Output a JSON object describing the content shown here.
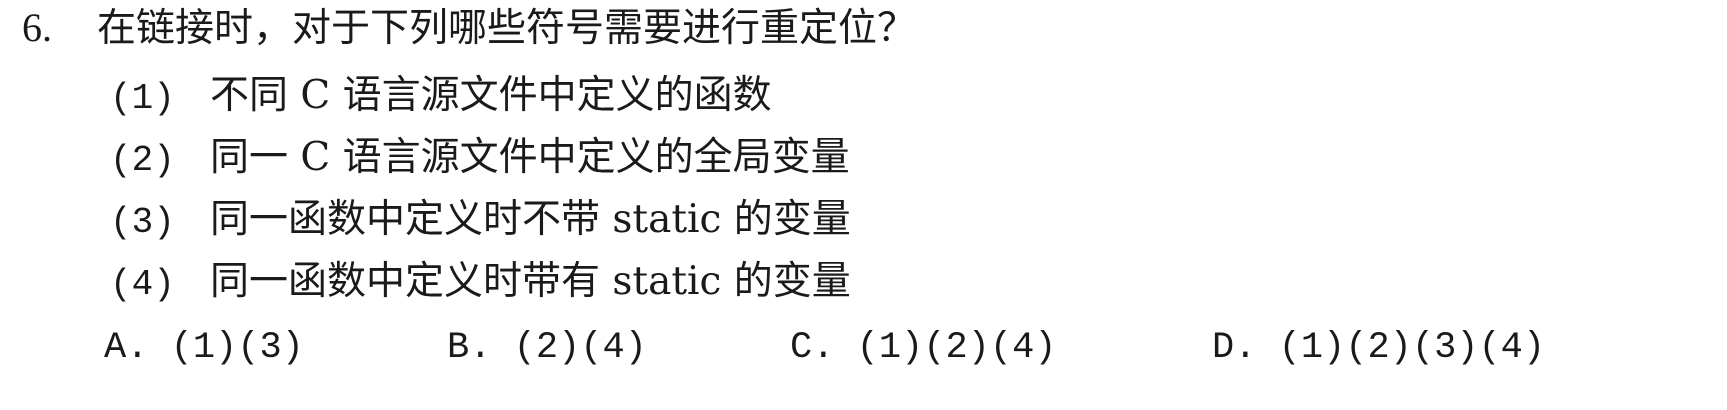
{
  "question": {
    "number": "6.",
    "text": "在链接时，对于下列哪些符号需要进行重定位？",
    "items": [
      {
        "number": "(1)",
        "text": "不同 C 语言源文件中定义的函数"
      },
      {
        "number": "(2)",
        "text": "同一 C 语言源文件中定义的全局变量"
      },
      {
        "number": "(3)",
        "text": "同一函数中定义时不带 static 的变量"
      },
      {
        "number": "(4)",
        "text": "同一函数中定义时带有 static 的变量"
      }
    ],
    "options": [
      {
        "label": "A.",
        "value": "(1)(3)"
      },
      {
        "label": "B.",
        "value": "(2)(4)"
      },
      {
        "label": "C.",
        "value": "(1)(2)(4)"
      },
      {
        "label": "D.",
        "value": "(1)(2)(3)(4)"
      }
    ]
  }
}
